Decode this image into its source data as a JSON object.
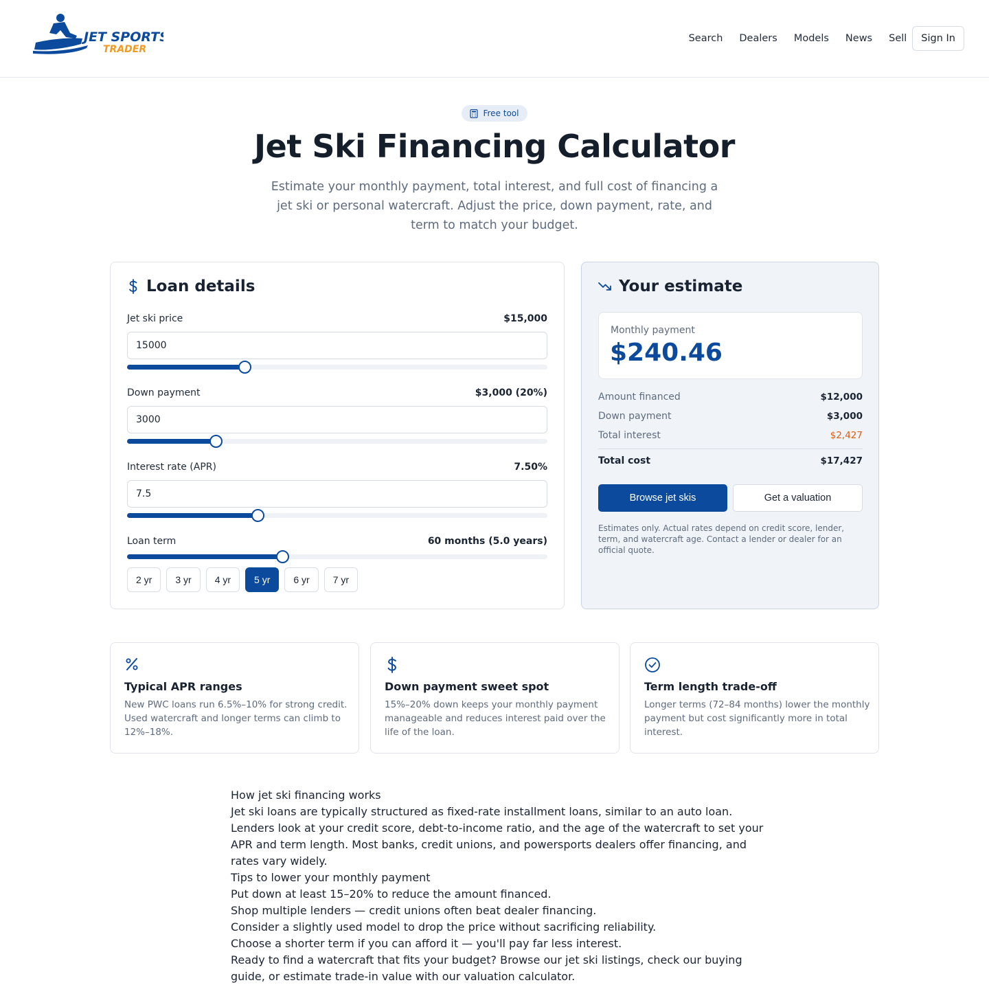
{
  "brand": {
    "name_line1": "JET SPORTS",
    "name_line2": "TRADER",
    "colors": {
      "primary": "#0b4a9c",
      "accent": "#f29a1f"
    }
  },
  "nav": {
    "items": [
      "Search",
      "Dealers",
      "Models",
      "News",
      "Sell"
    ],
    "signin_label": "Sign In"
  },
  "hero": {
    "badge": "Free tool",
    "title": "Jet Ski Financing Calculator",
    "subtitle": "Estimate your monthly payment, total interest, and full cost of financing a jet ski or personal watercraft. Adjust the price, down payment, rate, and term to match your budget."
  },
  "loan": {
    "title": "Loan details",
    "price": {
      "label": "Jet ski price",
      "display": "$15,000",
      "input": "15000",
      "slider_pct": 0.28
    },
    "down": {
      "label": "Down payment",
      "display": "$3,000 (20%)",
      "input": "3000",
      "slider_pct": 0.21
    },
    "rate": {
      "label": "Interest rate (APR)",
      "display": "7.50%",
      "input": "7.5",
      "slider_pct": 0.31
    },
    "term": {
      "label": "Loan term",
      "display": "60 months (5.0 years)",
      "slider_pct": 0.37
    },
    "term_buttons": [
      "2 yr",
      "3 yr",
      "4 yr",
      "5 yr",
      "6 yr",
      "7 yr"
    ],
    "term_selected": "5 yr"
  },
  "estimate": {
    "title": "Your estimate",
    "monthly_label": "Monthly payment",
    "monthly_value": "$240.46",
    "rows": [
      {
        "label": "Amount financed",
        "value": "$12,000"
      },
      {
        "label": "Down payment",
        "value": "$3,000"
      },
      {
        "label": "Total interest",
        "value": "$2,427"
      }
    ],
    "total": {
      "label": "Total cost",
      "value": "$17,427"
    },
    "browse_label": "Browse jet skis",
    "valuation_label": "Get a valuation",
    "disclaimer": "Estimates only. Actual rates depend on credit score, lender, term, and watercraft age. Contact a lender or dealer for an official quote."
  },
  "tips": [
    {
      "icon": "percent-icon",
      "title": "Typical APR ranges",
      "text": "New PWC loans run 6.5%–10% for strong credit. Used watercraft and longer terms can climb to 12%–18%."
    },
    {
      "icon": "dollar-icon",
      "title": "Down payment sweet spot",
      "text": "15%–20% down keeps your monthly payment manageable and reduces interest paid over the life of the loan."
    },
    {
      "icon": "check-circle-icon",
      "title": "Term length trade-off",
      "text": "Longer terms (72–84 months) lower the monthly payment but cost significantly more in total interest."
    }
  ],
  "article": {
    "heading1": "How jet ski financing works",
    "para1": "Jet ski loans are typically structured as fixed-rate installment loans, similar to an auto loan. Lenders look at your credit score, debt-to-income ratio, and the age of the watercraft to set your APR and term length. Most banks, credit unions, and powersports dealers offer financing, and rates vary widely.",
    "heading2": "Tips to lower your monthly payment",
    "tips": [
      "Put down at least 15–20% to reduce the amount financed.",
      "Shop multiple lenders — credit unions often beat dealer financing.",
      "Consider a slightly used model to drop the price without sacrificing reliability.",
      "Choose a shorter term if you can afford it — you'll pay far less interest."
    ],
    "closing": "Ready to find a watercraft that fits your budget? Browse our jet ski listings, check our buying guide, or estimate trade-in value with our valuation calculator."
  }
}
